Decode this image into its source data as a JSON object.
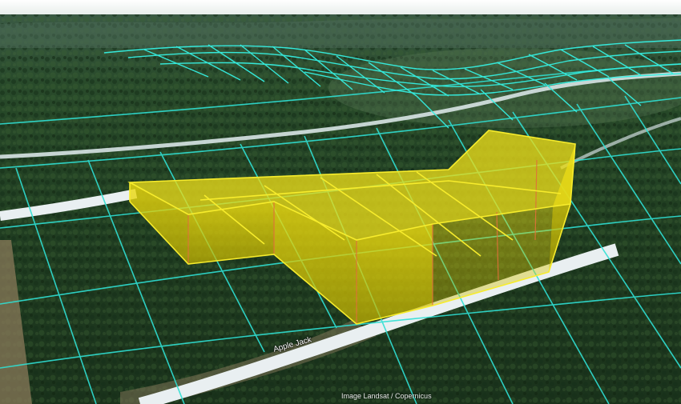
{
  "map": {
    "view": "3D satellite aerial view",
    "road_label": "Apple Jack",
    "attribution": "Image Landsat / Copernicus",
    "colors": {
      "sky": "#f3f5f4",
      "forest_dark": "#1b3a1c",
      "forest_mid": "#2d4f2b",
      "parcel_lines": "#2fe0d4",
      "road": "#e8eef0",
      "highlight_fill": "#e8d400",
      "highlight_edge": "#f2e600",
      "highlight_inner_edge": "#e0703a"
    }
  }
}
